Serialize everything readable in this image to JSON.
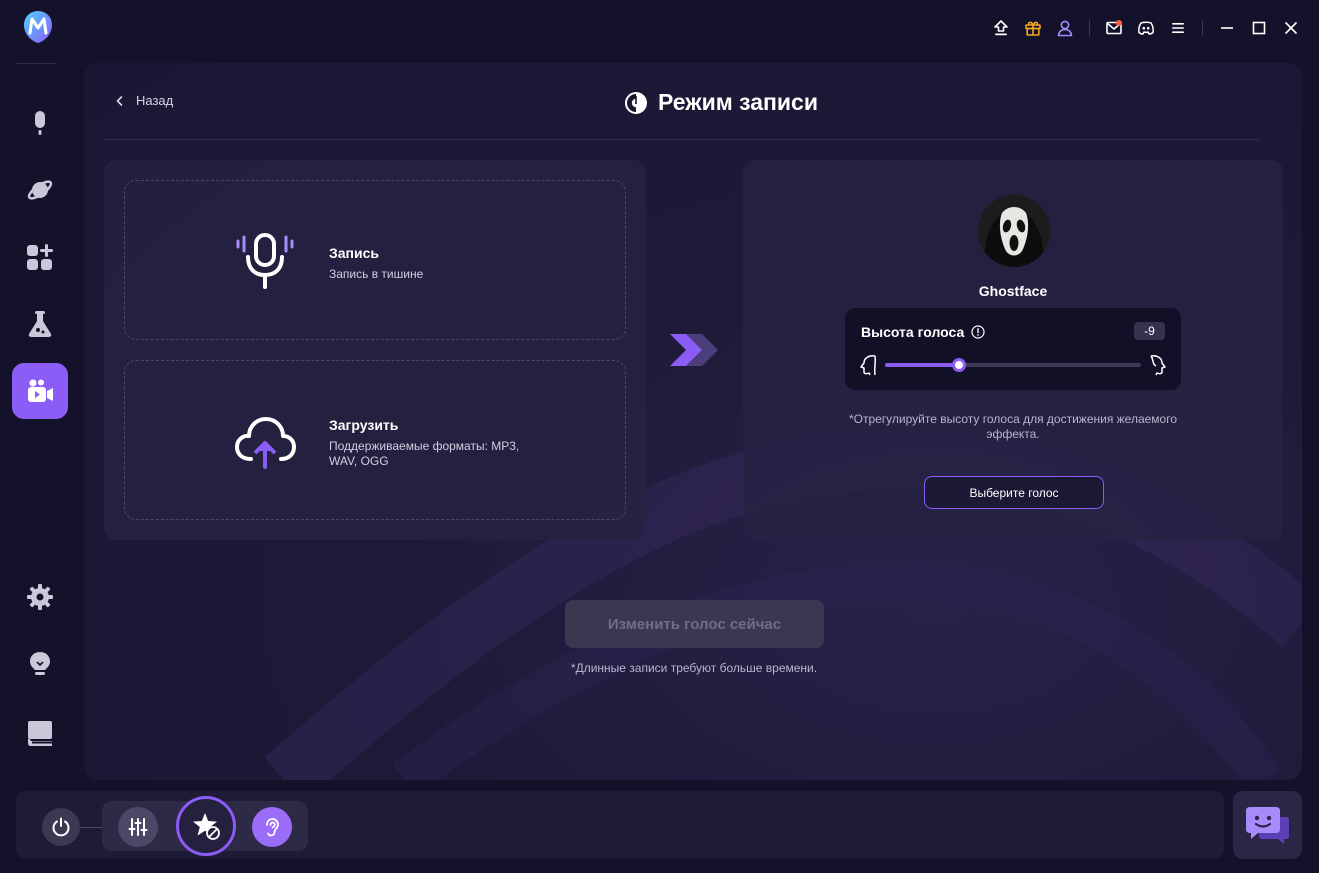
{
  "header": {
    "back_label": "Назад",
    "title": "Режим записи"
  },
  "options": {
    "record": {
      "title": "Запись",
      "subtitle": "Запись в тишине"
    },
    "upload": {
      "title": "Загрузить",
      "subtitle": "Поддерживаемые форматы: MP3, WAV, OGG"
    }
  },
  "voice": {
    "name": "Ghostface",
    "pitch_label": "Высота голоса",
    "pitch_value": "-9",
    "pitch_fill_fraction": 0.29,
    "hint": "*Отрегулируйте высоту голоса для достижения желаемого эффекта.",
    "choose_label": "Выберите голос"
  },
  "action": {
    "change_label": "Изменить голос сейчас",
    "note": "*Длинные записи требуют больше времени."
  },
  "icons": {
    "sidebar": [
      "microphone-icon",
      "planet-icon",
      "apps-add-icon",
      "flask-icon",
      "video-camera-icon",
      "gear-icon",
      "lightbulb-icon",
      "book-icon"
    ],
    "topbar": [
      "upload-icon",
      "gift-icon",
      "user-icon",
      "mail-icon",
      "discord-icon",
      "menu-icon",
      "minimize-icon",
      "maximize-icon",
      "close-icon"
    ],
    "bottombar": [
      "power-icon",
      "mixer-icon",
      "star-effect-icon",
      "ear-icon",
      "chat-icon"
    ]
  },
  "colors": {
    "accent": "#8b5cf6",
    "panel": "#262342",
    "background": "#13122a",
    "disabled_button": "#3a3851",
    "gift": "#f5a623",
    "notification_dot": "#ff5a3c"
  }
}
